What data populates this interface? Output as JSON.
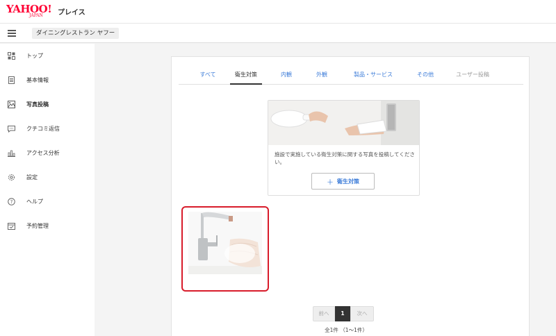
{
  "header": {
    "logo_main": "YAHOO!",
    "logo_sub": "JAPAN",
    "logo_product": "プレイス"
  },
  "subheader": {
    "store_name": "ダイニングレストラン ヤフー"
  },
  "sidebar": {
    "items": [
      {
        "label": "トップ",
        "icon": "dashboard-icon"
      },
      {
        "label": "基本情報",
        "icon": "document-icon"
      },
      {
        "label": "写真投稿",
        "icon": "image-icon",
        "active": true
      },
      {
        "label": "クチコミ返信",
        "icon": "chat-icon"
      },
      {
        "label": "アクセス分析",
        "icon": "bar-chart-icon"
      },
      {
        "label": "設定",
        "icon": "gear-icon"
      },
      {
        "label": "ヘルプ",
        "icon": "help-icon"
      },
      {
        "label": "予約管理",
        "icon": "calendar-icon"
      }
    ]
  },
  "tabs": [
    {
      "label": "すべて"
    },
    {
      "label": "衛生対策",
      "active": true
    },
    {
      "label": "内観"
    },
    {
      "label": "外観"
    },
    {
      "label": "製品・サービス"
    },
    {
      "label": "その他"
    },
    {
      "label": "ユーザー投稿",
      "disabled": true
    }
  ],
  "banner": {
    "description": "施設で実施している衛生対策に関する写真を投稿してください。",
    "add_button_label": "衛生対策",
    "add_button_icon": "plus-icon"
  },
  "pagination": {
    "prev_label": "前へ",
    "current_page": "1",
    "next_label": "次へ",
    "count_text": "全1件 （1〜1件）"
  },
  "colors": {
    "brand_red": "#ff0033",
    "link_blue": "#3b7bd8",
    "selected_border": "#d81b2a"
  }
}
